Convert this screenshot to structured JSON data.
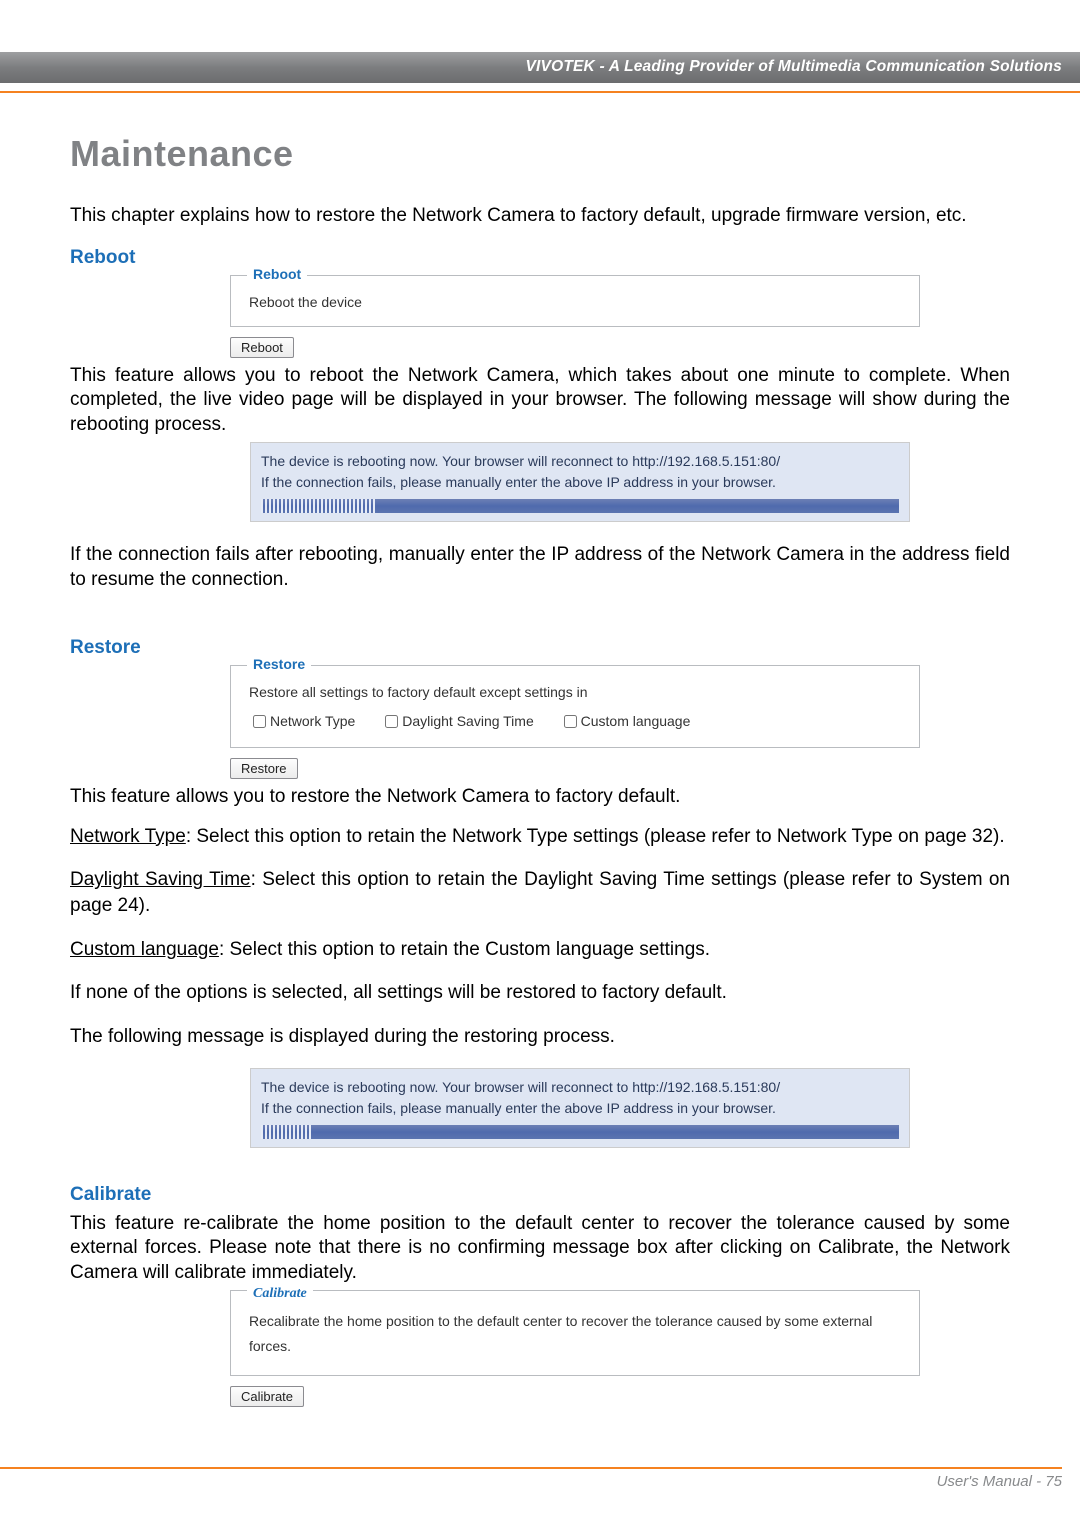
{
  "header": {
    "brand_line": "VIVOTEK - A Leading Provider of Multimedia Communication Solutions"
  },
  "title": "Maintenance",
  "intro": "This chapter explains how to restore the Network Camera to factory default, upgrade firmware version, etc.",
  "reboot": {
    "heading": "Reboot",
    "legend": "Reboot",
    "desc": "Reboot the device",
    "button": "Reboot",
    "para1": "This feature allows you to reboot the Network Camera, which takes about one minute to complete. When completed, the live video page will be displayed in your browser. The following message will show during the rebooting process.",
    "msg_line1": "The device is rebooting now. Your browser will reconnect to http://192.168.5.151:80/",
    "msg_line2": "If the connection fails, please manually enter the above IP address in your browser.",
    "progress_width": "18%",
    "para2": "If the connection fails after rebooting, manually enter the IP address of the Network Camera in the address field to resume the connection."
  },
  "restore": {
    "heading": "Restore",
    "legend": "Restore",
    "desc": "Restore all settings to factory default except settings in",
    "opt1": "Network Type",
    "opt2": "Daylight Saving Time",
    "opt3": "Custom language",
    "button": "Restore",
    "para_after": "This feature allows you to restore the Network Camera to factory default.",
    "nt_label": "Network Type",
    "nt_text": ": Select this option to retain the Network Type settings (please refer to Network Type on page 32).",
    "dst_label": "Daylight Saving Time",
    "dst_text": ": Select this option to retain the Daylight Saving Time settings (please refer to System on page 24).",
    "cl_label": "Custom language",
    "cl_text": ": Select this option to retain the Custom language settings.",
    "none_text": "If none of the options is selected, all settings will be restored to factory default.",
    "msg_intro": "The following message is displayed during the restoring process.",
    "msg_line1": "The device is rebooting now. Your browser will reconnect to http://192.168.5.151:80/",
    "msg_line2": "If the connection fails, please manually enter the above IP address in your browser.",
    "progress_width": "8%"
  },
  "calibrate": {
    "heading": "Calibrate",
    "para": "This feature re-calibrate the home position to the default center to recover the tolerance caused by some external forces. Please note that there is no confirming message box after clicking on Calibrate, the Network Camera will calibrate immediately.",
    "legend": "Calibrate",
    "desc": "Recalibrate the home position to the default center to recover the tolerance caused by some external forces.",
    "button": "Calibrate"
  },
  "footer": {
    "text": "User's Manual - 75"
  }
}
